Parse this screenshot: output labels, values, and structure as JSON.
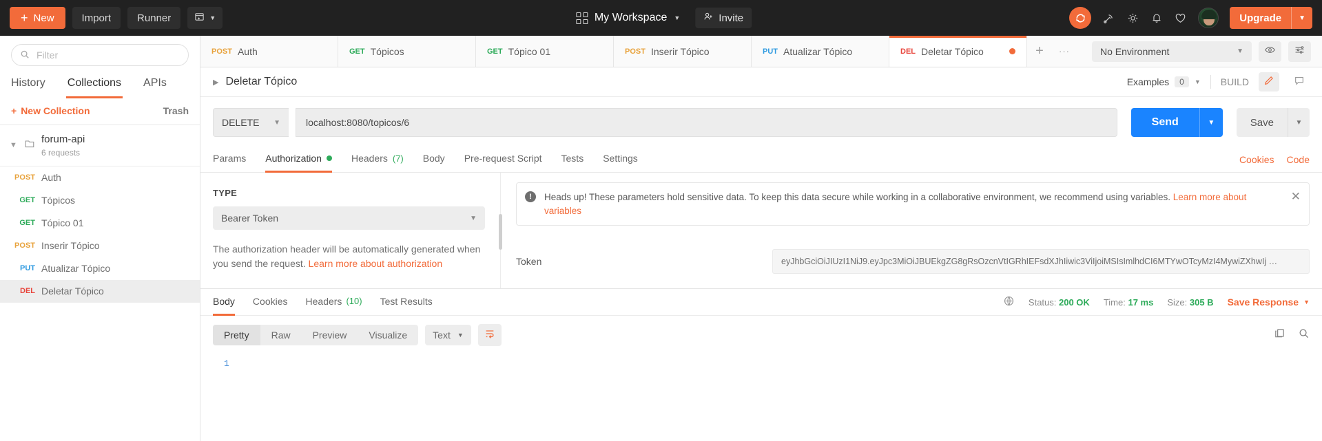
{
  "topbar": {
    "new_label": "New",
    "import_label": "Import",
    "runner_label": "Runner",
    "workspace_label": "My Workspace",
    "invite_label": "Invite",
    "upgrade_label": "Upgrade",
    "icons": [
      "sync-icon",
      "satellite-icon",
      "gear-icon",
      "bell-icon",
      "heart-icon",
      "avatar"
    ],
    "accent_color": "#f26b3a",
    "background_color": "#212121"
  },
  "sidebar": {
    "filter_placeholder": "Filter",
    "tabs": [
      {
        "label": "History",
        "active": false
      },
      {
        "label": "Collections",
        "active": true
      },
      {
        "label": "APIs",
        "active": false
      }
    ],
    "new_collection_label": "New Collection",
    "trash_label": "Trash",
    "collection": {
      "name": "forum-api",
      "subtitle": "6 requests"
    },
    "requests": [
      {
        "method": "POST",
        "name": "Auth",
        "selected": false
      },
      {
        "method": "GET",
        "name": "Tópicos",
        "selected": false
      },
      {
        "method": "GET",
        "name": "Tópico 01",
        "selected": false
      },
      {
        "method": "POST",
        "name": "Inserir Tópico",
        "selected": false
      },
      {
        "method": "PUT",
        "name": "Atualizar Tópico",
        "selected": false
      },
      {
        "method": "DEL",
        "name": "Deletar Tópico",
        "selected": true
      }
    ]
  },
  "tabstrip": {
    "tabs": [
      {
        "method": "POST",
        "name": "Auth",
        "active": false,
        "unsaved": false
      },
      {
        "method": "GET",
        "name": "Tópicos",
        "active": false,
        "unsaved": false
      },
      {
        "method": "GET",
        "name": "Tópico 01",
        "active": false,
        "unsaved": false
      },
      {
        "method": "POST",
        "name": "Inserir Tópico",
        "active": false,
        "unsaved": false
      },
      {
        "method": "PUT",
        "name": "Atualizar Tópico",
        "active": false,
        "unsaved": false
      },
      {
        "method": "DEL",
        "name": "Deletar Tópico",
        "active": true,
        "unsaved": true
      }
    ],
    "add_label": "+",
    "more_label": "···",
    "environment": "No Environment"
  },
  "crumb": {
    "title": "Deletar Tópico",
    "examples_label": "Examples",
    "examples_count": "0",
    "build_label": "BUILD"
  },
  "url": {
    "method": "DELETE",
    "value": "localhost:8080/topicos/6",
    "send_label": "Send",
    "save_label": "Save"
  },
  "request_tabs": {
    "tabs": [
      {
        "label": "Params",
        "active": false,
        "dot": false,
        "count": ""
      },
      {
        "label": "Authorization",
        "active": true,
        "dot": true,
        "count": ""
      },
      {
        "label": "Headers",
        "active": false,
        "dot": false,
        "count": "(7)"
      },
      {
        "label": "Body",
        "active": false,
        "dot": false,
        "count": ""
      },
      {
        "label": "Pre-request Script",
        "active": false,
        "dot": false,
        "count": ""
      },
      {
        "label": "Tests",
        "active": false,
        "dot": false,
        "count": ""
      },
      {
        "label": "Settings",
        "active": false,
        "dot": false,
        "count": ""
      }
    ],
    "cookies_label": "Cookies",
    "code_label": "Code"
  },
  "auth": {
    "type_title": "TYPE",
    "type_value": "Bearer Token",
    "help_text": "The authorization header will be automatically generated when you send the request. ",
    "help_link": "Learn more about authorization",
    "banner_text": "Heads up! These parameters hold sensitive data. To keep this data secure while working in a collaborative environment, we recommend using variables. ",
    "banner_link": "Learn more about variables",
    "token_label": "Token",
    "token_value": "eyJhbGciOiJIUzI1NiJ9.eyJpc3MiOiJBUEkgZG8gRsOzcnVtIGRhIEFsdXJhIiwic3ViIjoiMSIsImlhdCI6MTYwOTcyMzI4MywiZXhwIj …"
  },
  "response": {
    "tabs": [
      {
        "label": "Body",
        "active": true,
        "count": ""
      },
      {
        "label": "Cookies",
        "active": false,
        "count": ""
      },
      {
        "label": "Headers",
        "active": false,
        "count": "(10)"
      },
      {
        "label": "Test Results",
        "active": false,
        "count": ""
      }
    ],
    "status_key": "Status:",
    "status_value": "200 OK",
    "time_key": "Time:",
    "time_value": "17 ms",
    "size_key": "Size:",
    "size_value": "305 B",
    "save_response_label": "Save Response",
    "view_segments": [
      {
        "label": "Pretty",
        "active": true
      },
      {
        "label": "Raw",
        "active": false
      },
      {
        "label": "Preview",
        "active": false
      },
      {
        "label": "Visualize",
        "active": false
      }
    ],
    "format": "Text",
    "line_number": "1",
    "body": ""
  }
}
